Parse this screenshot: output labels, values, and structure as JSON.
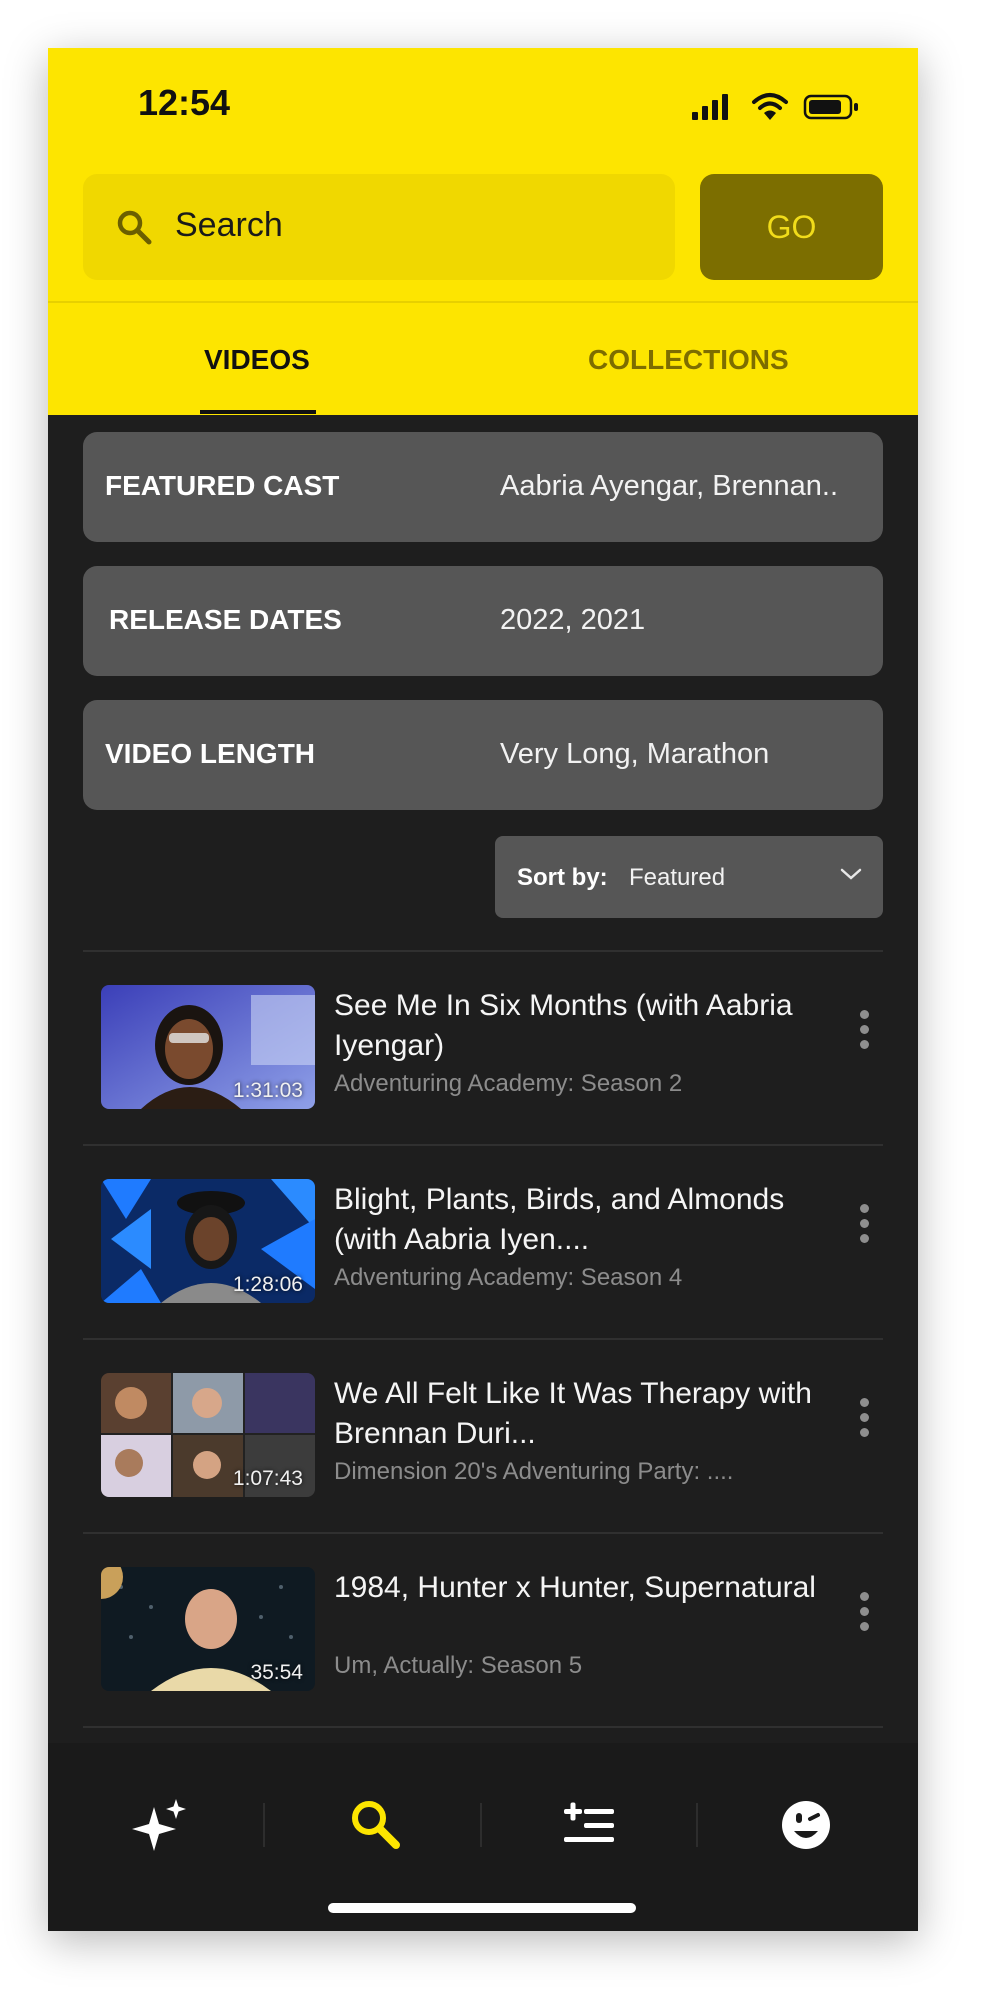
{
  "status_bar": {
    "time": "12:54"
  },
  "search": {
    "placeholder": "Search",
    "go_label": "GO"
  },
  "tabs": [
    {
      "label": "VIDEOS",
      "active": true
    },
    {
      "label": "COLLECTIONS",
      "active": false
    }
  ],
  "filters": [
    {
      "label": "FEATURED CAST",
      "value": "Aabria Ayengar, Brennan.."
    },
    {
      "label": "RELEASE DATES",
      "value": "2022, 2021"
    },
    {
      "label": "VIDEO LENGTH",
      "value": "Very Long, Marathon"
    }
  ],
  "sort": {
    "label": "Sort by:",
    "value": "Featured"
  },
  "videos": [
    {
      "title": "See Me In Six Months (with Aabria Iyengar)",
      "subtitle": "Adventuring Academy: Season 2",
      "duration": "1:31:03"
    },
    {
      "title": "Blight, Plants, Birds, and Almonds (with Aabria Iyen....",
      "subtitle": "Adventuring Academy: Season 4",
      "duration": "1:28:06"
    },
    {
      "title": "We All Felt Like It Was Therapy with Brennan Duri...",
      "subtitle": "Dimension 20's Adventuring Party: ....",
      "duration": "1:07:43"
    },
    {
      "title": "1984, Hunter x Hunter, Supernatural",
      "subtitle": "Um, Actually: Season 5",
      "duration": "35:54"
    }
  ],
  "nav": [
    {
      "icon": "sparkles-icon",
      "active": false
    },
    {
      "icon": "search-icon",
      "active": true
    },
    {
      "icon": "queue-add-icon",
      "active": false
    },
    {
      "icon": "profile-face-icon",
      "active": false
    }
  ],
  "colors": {
    "accent": "#fde500",
    "go_button": "#7c6e00",
    "background": "#1e1e1e",
    "filter_bg": "#565656"
  }
}
